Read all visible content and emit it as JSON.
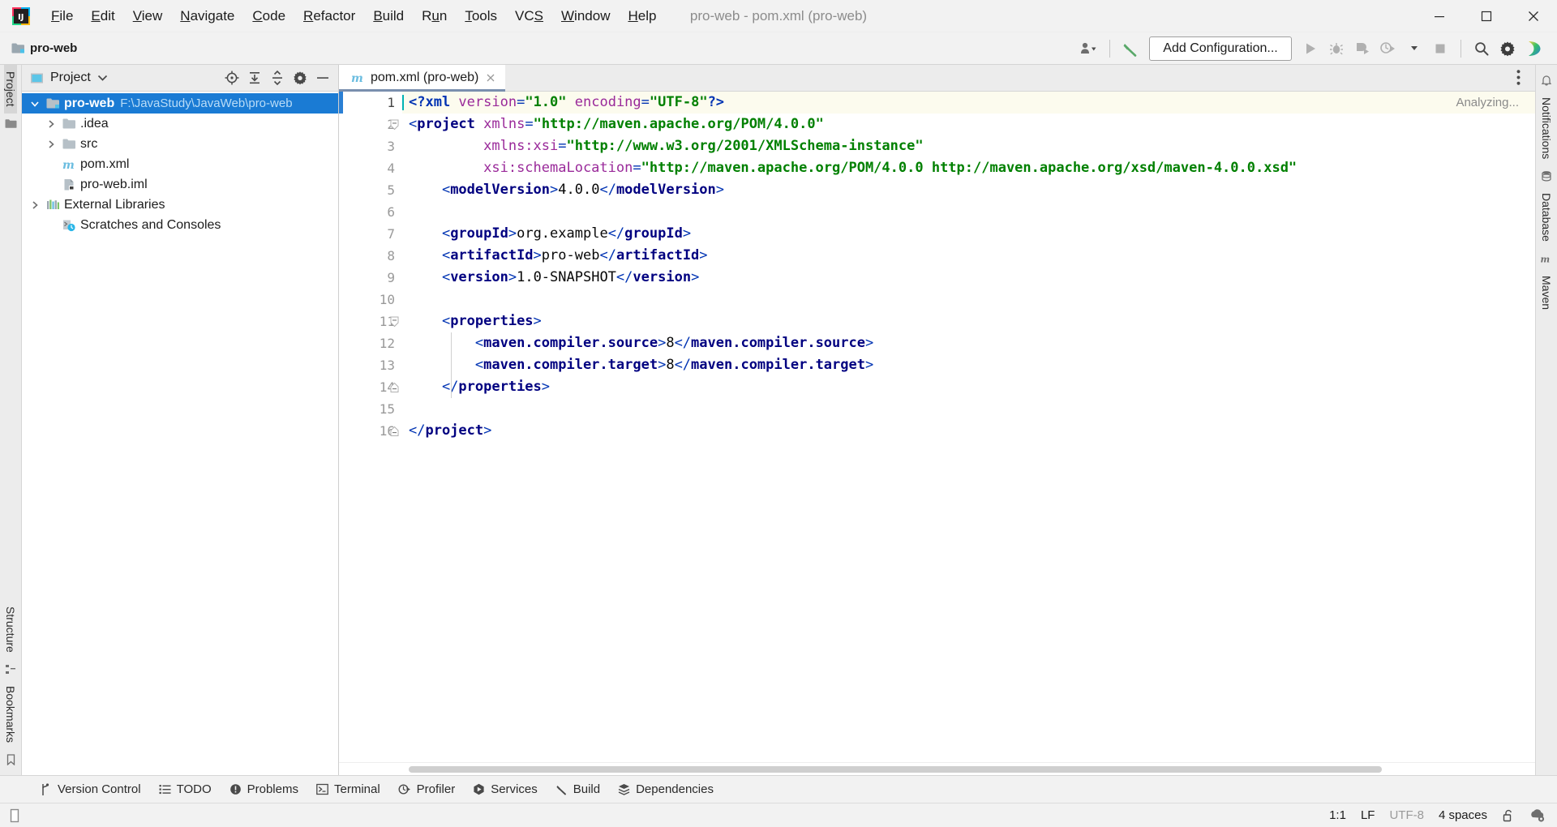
{
  "window": {
    "title": "pro-web - pom.xml (pro-web)",
    "controls": {
      "minimize": "minimize-icon",
      "maximize": "maximize-icon",
      "close": "close-icon"
    }
  },
  "menubar": {
    "items": [
      {
        "label": "File",
        "mnemonic": "F"
      },
      {
        "label": "Edit",
        "mnemonic": "E"
      },
      {
        "label": "View",
        "mnemonic": "V"
      },
      {
        "label": "Navigate",
        "mnemonic": "N"
      },
      {
        "label": "Code",
        "mnemonic": "C"
      },
      {
        "label": "Refactor",
        "mnemonic": "R"
      },
      {
        "label": "Build",
        "mnemonic": "B"
      },
      {
        "label": "Run",
        "mnemonic": "u"
      },
      {
        "label": "Tools",
        "mnemonic": "T"
      },
      {
        "label": "VCS",
        "mnemonic": "S"
      },
      {
        "label": "Window",
        "mnemonic": "W"
      },
      {
        "label": "Help",
        "mnemonic": "H"
      }
    ]
  },
  "navbar": {
    "breadcrumb": "pro-web",
    "add_configuration_label": "Add Configuration...",
    "icons": [
      "user-avatar-icon",
      "build-hammer-icon",
      "run-icon",
      "debug-icon",
      "run-coverage-icon",
      "profile-icon",
      "stop-icon",
      "search-everywhere-icon",
      "settings-gear-icon",
      "ide-assistant-icon"
    ]
  },
  "left_rail": {
    "tabs": [
      "Project",
      "Structure",
      "Bookmarks"
    ],
    "active": "Project"
  },
  "right_rail": {
    "tabs": [
      "Notifications",
      "Database",
      "Maven"
    ]
  },
  "project_panel": {
    "title": "Project",
    "actions": [
      "select-opened-file-icon",
      "expand-all-icon",
      "collapse-all-icon",
      "settings-gear-icon",
      "hide-icon"
    ],
    "tree": [
      {
        "label": "pro-web",
        "path": "F:\\JavaStudy\\JavaWeb\\pro-web",
        "icon": "project-folder-icon",
        "arrow": "expanded",
        "depth": 0,
        "selected": true,
        "bold": true
      },
      {
        "label": ".idea",
        "path": "",
        "icon": "folder-icon",
        "arrow": "collapsed",
        "depth": 1,
        "selected": false,
        "bold": false
      },
      {
        "label": "src",
        "path": "",
        "icon": "folder-icon",
        "arrow": "collapsed",
        "depth": 1,
        "selected": false,
        "bold": false
      },
      {
        "label": "pom.xml",
        "path": "",
        "icon": "maven-file-icon",
        "arrow": "none",
        "depth": 1,
        "selected": false,
        "bold": false
      },
      {
        "label": "pro-web.iml",
        "path": "",
        "icon": "iml-file-icon",
        "arrow": "none",
        "depth": 1,
        "selected": false,
        "bold": false
      },
      {
        "label": "External Libraries",
        "path": "",
        "icon": "libraries-icon",
        "arrow": "collapsed",
        "depth": 0,
        "selected": false,
        "bold": false
      },
      {
        "label": "Scratches and Consoles",
        "path": "",
        "icon": "scratches-icon",
        "arrow": "none",
        "depth": 0,
        "selected": false,
        "bold": false
      }
    ]
  },
  "editor": {
    "tab": {
      "label": "pom.xml (pro-web)",
      "icon": "maven-file-icon",
      "close": "close-icon"
    },
    "status_overlay": "Analyzing...",
    "options_icon": "more-options-icon",
    "lines": [
      {
        "n": 1,
        "indent": 0,
        "fold": "",
        "current": true,
        "tokens": [
          {
            "t": "<?xml ",
            "c": "pi"
          },
          {
            "t": "version",
            "c": "attr"
          },
          {
            "t": "=",
            "c": "punct"
          },
          {
            "t": "\"1.0\"",
            "c": "str"
          },
          {
            "t": " ",
            "c": "txt"
          },
          {
            "t": "encoding",
            "c": "attr"
          },
          {
            "t": "=",
            "c": "punct"
          },
          {
            "t": "\"UTF-8\"",
            "c": "str"
          },
          {
            "t": "?>",
            "c": "pi"
          }
        ]
      },
      {
        "n": 2,
        "indent": 0,
        "fold": "open",
        "current": false,
        "tokens": [
          {
            "t": "<",
            "c": "punct"
          },
          {
            "t": "project",
            "c": "tagname"
          },
          {
            "t": " ",
            "c": "txt"
          },
          {
            "t": "xmlns",
            "c": "attr"
          },
          {
            "t": "=",
            "c": "punct"
          },
          {
            "t": "\"http://maven.apache.org/POM/4.0.0\"",
            "c": "str"
          }
        ]
      },
      {
        "n": 3,
        "indent": 0,
        "fold": "",
        "current": false,
        "tokens": [
          {
            "t": "         ",
            "c": "txt"
          },
          {
            "t": "xmlns:xsi",
            "c": "attr"
          },
          {
            "t": "=",
            "c": "punct"
          },
          {
            "t": "\"http://www.w3.org/2001/XMLSchema-instance\"",
            "c": "str"
          }
        ]
      },
      {
        "n": 4,
        "indent": 0,
        "fold": "",
        "current": false,
        "tokens": [
          {
            "t": "         ",
            "c": "txt"
          },
          {
            "t": "xsi:schemaLocation",
            "c": "attr"
          },
          {
            "t": "=",
            "c": "punct"
          },
          {
            "t": "\"http://maven.apache.org/POM/4.0.0 http://maven.apache.org/xsd/maven-4.0.0.xsd\"",
            "c": "str"
          }
        ]
      },
      {
        "n": 5,
        "indent": 0,
        "fold": "",
        "current": false,
        "tokens": [
          {
            "t": "    <",
            "c": "punct"
          },
          {
            "t": "modelVersion",
            "c": "tagname"
          },
          {
            "t": ">",
            "c": "punct"
          },
          {
            "t": "4.0.0",
            "c": "txt"
          },
          {
            "t": "</",
            "c": "punct"
          },
          {
            "t": "modelVersion",
            "c": "tagname"
          },
          {
            "t": ">",
            "c": "punct"
          }
        ]
      },
      {
        "n": 6,
        "indent": 0,
        "fold": "",
        "current": false,
        "tokens": []
      },
      {
        "n": 7,
        "indent": 0,
        "fold": "",
        "current": false,
        "tokens": [
          {
            "t": "    <",
            "c": "punct"
          },
          {
            "t": "groupId",
            "c": "tagname"
          },
          {
            "t": ">",
            "c": "punct"
          },
          {
            "t": "org.example",
            "c": "txt"
          },
          {
            "t": "</",
            "c": "punct"
          },
          {
            "t": "groupId",
            "c": "tagname"
          },
          {
            "t": ">",
            "c": "punct"
          }
        ]
      },
      {
        "n": 8,
        "indent": 0,
        "fold": "",
        "current": false,
        "tokens": [
          {
            "t": "    <",
            "c": "punct"
          },
          {
            "t": "artifactId",
            "c": "tagname"
          },
          {
            "t": ">",
            "c": "punct"
          },
          {
            "t": "pro-web",
            "c": "txt"
          },
          {
            "t": "</",
            "c": "punct"
          },
          {
            "t": "artifactId",
            "c": "tagname"
          },
          {
            "t": ">",
            "c": "punct"
          }
        ]
      },
      {
        "n": 9,
        "indent": 0,
        "fold": "",
        "current": false,
        "tokens": [
          {
            "t": "    <",
            "c": "punct"
          },
          {
            "t": "version",
            "c": "tagname"
          },
          {
            "t": ">",
            "c": "punct"
          },
          {
            "t": "1.0-SNAPSHOT",
            "c": "txt"
          },
          {
            "t": "</",
            "c": "punct"
          },
          {
            "t": "version",
            "c": "tagname"
          },
          {
            "t": ">",
            "c": "punct"
          }
        ]
      },
      {
        "n": 10,
        "indent": 0,
        "fold": "",
        "current": false,
        "tokens": []
      },
      {
        "n": 11,
        "indent": 0,
        "fold": "open",
        "current": false,
        "tokens": [
          {
            "t": "    <",
            "c": "punct"
          },
          {
            "t": "properties",
            "c": "tagname"
          },
          {
            "t": ">",
            "c": "punct"
          }
        ]
      },
      {
        "n": 12,
        "indent": 0,
        "fold": "",
        "current": false,
        "tokens": [
          {
            "t": "        <",
            "c": "punct"
          },
          {
            "t": "maven.compiler.source",
            "c": "tagname"
          },
          {
            "t": ">",
            "c": "punct"
          },
          {
            "t": "8",
            "c": "txt"
          },
          {
            "t": "</",
            "c": "punct"
          },
          {
            "t": "maven.compiler.source",
            "c": "tagname"
          },
          {
            "t": ">",
            "c": "punct"
          }
        ]
      },
      {
        "n": 13,
        "indent": 0,
        "fold": "",
        "current": false,
        "tokens": [
          {
            "t": "        <",
            "c": "punct"
          },
          {
            "t": "maven.compiler.target",
            "c": "tagname"
          },
          {
            "t": ">",
            "c": "punct"
          },
          {
            "t": "8",
            "c": "txt"
          },
          {
            "t": "</",
            "c": "punct"
          },
          {
            "t": "maven.compiler.target",
            "c": "tagname"
          },
          {
            "t": ">",
            "c": "punct"
          }
        ]
      },
      {
        "n": 14,
        "indent": 0,
        "fold": "close",
        "current": false,
        "tokens": [
          {
            "t": "    </",
            "c": "punct"
          },
          {
            "t": "properties",
            "c": "tagname"
          },
          {
            "t": ">",
            "c": "punct"
          }
        ]
      },
      {
        "n": 15,
        "indent": 0,
        "fold": "",
        "current": false,
        "tokens": []
      },
      {
        "n": 16,
        "indent": 0,
        "fold": "close",
        "current": false,
        "tokens": [
          {
            "t": "</",
            "c": "punct"
          },
          {
            "t": "project",
            "c": "tagname"
          },
          {
            "t": ">",
            "c": "punct"
          }
        ]
      }
    ]
  },
  "toolwindow_bar": {
    "buttons": [
      {
        "label": "Version Control",
        "icon": "version-control-icon"
      },
      {
        "label": "TODO",
        "icon": "todo-list-icon"
      },
      {
        "label": "Problems",
        "icon": "problems-icon"
      },
      {
        "label": "Terminal",
        "icon": "terminal-icon"
      },
      {
        "label": "Profiler",
        "icon": "profiler-icon"
      },
      {
        "label": "Services",
        "icon": "services-icon"
      },
      {
        "label": "Build",
        "icon": "build-hammer-icon"
      },
      {
        "label": "Dependencies",
        "icon": "dependencies-icon"
      }
    ]
  },
  "statusbar": {
    "left_icon": "memory-indicator-icon",
    "caret_position": "1:1",
    "line_separator": "LF",
    "encoding": "UTF-8",
    "indent": "4 spaces",
    "lock_icon": "unlocked-icon",
    "help_icon": "event-log-icon"
  },
  "colors": {
    "selection_blue": "#1a7bd4",
    "tag_blue": "#000080",
    "string_green": "#008000",
    "attr_purple": "#9a2a9a",
    "punct_blue": "#0033b3",
    "current_line": "#fcfbee",
    "chrome_gray": "#f2f2f2",
    "panel_gray": "#ececec"
  }
}
